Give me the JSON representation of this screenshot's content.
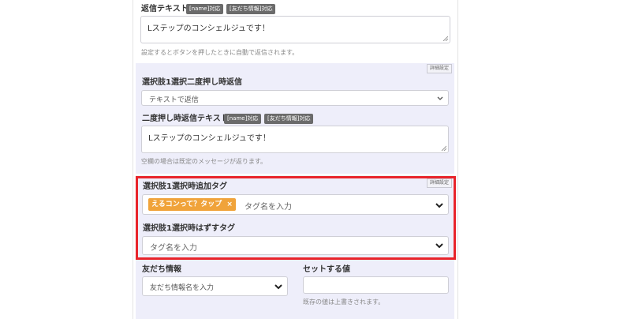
{
  "reply": {
    "label": "返信テキスト",
    "badge_name": "[name]対応",
    "badge_friend": "[友だち情報]対応",
    "value": "Lステップのコンシェルジュです！",
    "help": "設定するとボタンを押したときに自動で返信されます。"
  },
  "section1": {
    "advanced_label": "詳細設定",
    "double_press_label": "選択肢1選択二度押し時返信",
    "double_press_select": "テキストで返信",
    "double_text_label": "二度押し時返信テキスト",
    "badge_name": "[name]対応",
    "badge_friend": "[友だち情報]対応",
    "double_text_value": "Lステップのコンシェルジュです！",
    "double_text_help": "空欄の場合は既定のメッセージが返ります。"
  },
  "section2": {
    "advanced_label": "詳細設定",
    "add_tag_label": "選択肢1選択時追加タグ",
    "selected_tag": "えるコンって？タップ",
    "tag_remove": "×",
    "tag_placeholder": "タグ名を入力",
    "remove_tag_label": "選択肢1選択時はずすタグ",
    "remove_tag_placeholder": "タグ名を入力"
  },
  "friend": {
    "info_label": "友だち情報",
    "info_placeholder": "友だち情報名を入力",
    "value_label": "セットする値",
    "value_input": "",
    "value_help": "既存の値は上書きされます。"
  },
  "colors": {
    "panel": "#eeeefa",
    "highlight": "#e8242b",
    "tag": "#f0a33a",
    "badge": "#6b6b6b"
  },
  "icons": [
    "chevron-down-icon",
    "close-icon",
    "resize-grip-icon"
  ]
}
